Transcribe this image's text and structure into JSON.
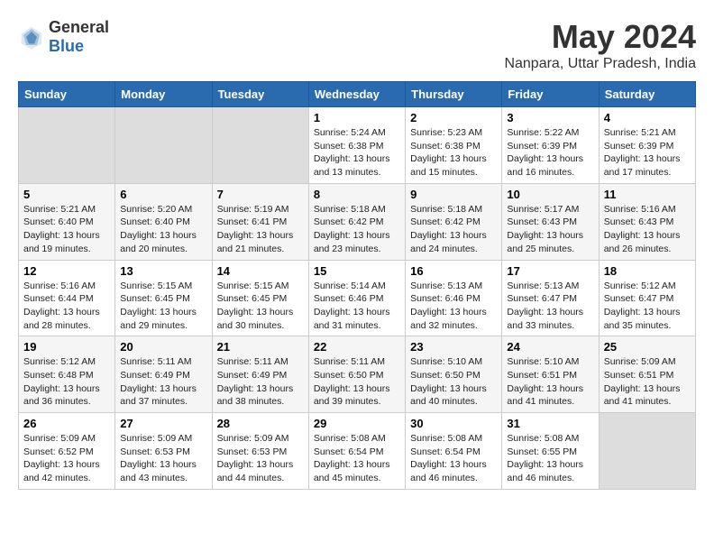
{
  "header": {
    "logo_general": "General",
    "logo_blue": "Blue",
    "month": "May 2024",
    "location": "Nanpara, Uttar Pradesh, India"
  },
  "days_of_week": [
    "Sunday",
    "Monday",
    "Tuesday",
    "Wednesday",
    "Thursday",
    "Friday",
    "Saturday"
  ],
  "weeks": [
    {
      "days": [
        {
          "num": "",
          "info": ""
        },
        {
          "num": "",
          "info": ""
        },
        {
          "num": "",
          "info": ""
        },
        {
          "num": "1",
          "info": "Sunrise: 5:24 AM\nSunset: 6:38 PM\nDaylight: 13 hours\nand 13 minutes."
        },
        {
          "num": "2",
          "info": "Sunrise: 5:23 AM\nSunset: 6:38 PM\nDaylight: 13 hours\nand 15 minutes."
        },
        {
          "num": "3",
          "info": "Sunrise: 5:22 AM\nSunset: 6:39 PM\nDaylight: 13 hours\nand 16 minutes."
        },
        {
          "num": "4",
          "info": "Sunrise: 5:21 AM\nSunset: 6:39 PM\nDaylight: 13 hours\nand 17 minutes."
        }
      ]
    },
    {
      "days": [
        {
          "num": "5",
          "info": "Sunrise: 5:21 AM\nSunset: 6:40 PM\nDaylight: 13 hours\nand 19 minutes."
        },
        {
          "num": "6",
          "info": "Sunrise: 5:20 AM\nSunset: 6:40 PM\nDaylight: 13 hours\nand 20 minutes."
        },
        {
          "num": "7",
          "info": "Sunrise: 5:19 AM\nSunset: 6:41 PM\nDaylight: 13 hours\nand 21 minutes."
        },
        {
          "num": "8",
          "info": "Sunrise: 5:18 AM\nSunset: 6:42 PM\nDaylight: 13 hours\nand 23 minutes."
        },
        {
          "num": "9",
          "info": "Sunrise: 5:18 AM\nSunset: 6:42 PM\nDaylight: 13 hours\nand 24 minutes."
        },
        {
          "num": "10",
          "info": "Sunrise: 5:17 AM\nSunset: 6:43 PM\nDaylight: 13 hours\nand 25 minutes."
        },
        {
          "num": "11",
          "info": "Sunrise: 5:16 AM\nSunset: 6:43 PM\nDaylight: 13 hours\nand 26 minutes."
        }
      ]
    },
    {
      "days": [
        {
          "num": "12",
          "info": "Sunrise: 5:16 AM\nSunset: 6:44 PM\nDaylight: 13 hours\nand 28 minutes."
        },
        {
          "num": "13",
          "info": "Sunrise: 5:15 AM\nSunset: 6:45 PM\nDaylight: 13 hours\nand 29 minutes."
        },
        {
          "num": "14",
          "info": "Sunrise: 5:15 AM\nSunset: 6:45 PM\nDaylight: 13 hours\nand 30 minutes."
        },
        {
          "num": "15",
          "info": "Sunrise: 5:14 AM\nSunset: 6:46 PM\nDaylight: 13 hours\nand 31 minutes."
        },
        {
          "num": "16",
          "info": "Sunrise: 5:13 AM\nSunset: 6:46 PM\nDaylight: 13 hours\nand 32 minutes."
        },
        {
          "num": "17",
          "info": "Sunrise: 5:13 AM\nSunset: 6:47 PM\nDaylight: 13 hours\nand 33 minutes."
        },
        {
          "num": "18",
          "info": "Sunrise: 5:12 AM\nSunset: 6:47 PM\nDaylight: 13 hours\nand 35 minutes."
        }
      ]
    },
    {
      "days": [
        {
          "num": "19",
          "info": "Sunrise: 5:12 AM\nSunset: 6:48 PM\nDaylight: 13 hours\nand 36 minutes."
        },
        {
          "num": "20",
          "info": "Sunrise: 5:11 AM\nSunset: 6:49 PM\nDaylight: 13 hours\nand 37 minutes."
        },
        {
          "num": "21",
          "info": "Sunrise: 5:11 AM\nSunset: 6:49 PM\nDaylight: 13 hours\nand 38 minutes."
        },
        {
          "num": "22",
          "info": "Sunrise: 5:11 AM\nSunset: 6:50 PM\nDaylight: 13 hours\nand 39 minutes."
        },
        {
          "num": "23",
          "info": "Sunrise: 5:10 AM\nSunset: 6:50 PM\nDaylight: 13 hours\nand 40 minutes."
        },
        {
          "num": "24",
          "info": "Sunrise: 5:10 AM\nSunset: 6:51 PM\nDaylight: 13 hours\nand 41 minutes."
        },
        {
          "num": "25",
          "info": "Sunrise: 5:09 AM\nSunset: 6:51 PM\nDaylight: 13 hours\nand 41 minutes."
        }
      ]
    },
    {
      "days": [
        {
          "num": "26",
          "info": "Sunrise: 5:09 AM\nSunset: 6:52 PM\nDaylight: 13 hours\nand 42 minutes."
        },
        {
          "num": "27",
          "info": "Sunrise: 5:09 AM\nSunset: 6:53 PM\nDaylight: 13 hours\nand 43 minutes."
        },
        {
          "num": "28",
          "info": "Sunrise: 5:09 AM\nSunset: 6:53 PM\nDaylight: 13 hours\nand 44 minutes."
        },
        {
          "num": "29",
          "info": "Sunrise: 5:08 AM\nSunset: 6:54 PM\nDaylight: 13 hours\nand 45 minutes."
        },
        {
          "num": "30",
          "info": "Sunrise: 5:08 AM\nSunset: 6:54 PM\nDaylight: 13 hours\nand 46 minutes."
        },
        {
          "num": "31",
          "info": "Sunrise: 5:08 AM\nSunset: 6:55 PM\nDaylight: 13 hours\nand 46 minutes."
        },
        {
          "num": "",
          "info": ""
        }
      ]
    }
  ]
}
